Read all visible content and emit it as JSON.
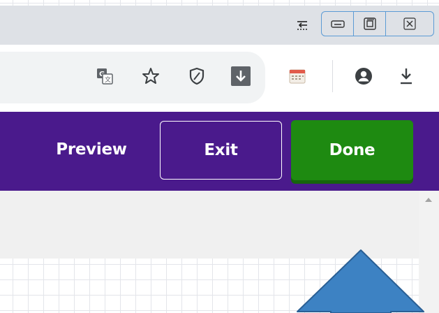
{
  "window_controls": {
    "pin_icon": "pin-icon",
    "minimize_icon": "minimize-icon",
    "restore_icon": "restore-icon",
    "close_icon": "close-icon"
  },
  "browser_toolbar": {
    "icons": [
      "translate-icon",
      "star-icon",
      "shield-icon",
      "download-box-icon",
      "calendar-extension-icon",
      "account-icon",
      "download-icon"
    ],
    "colors": {
      "titlebar": "#dee1e6",
      "omnibox": "#f1f3f4",
      "icon": "#3c4043",
      "download_box": "#5f6368"
    }
  },
  "editor_bar": {
    "preview_label": "Preview",
    "exit_label": "Exit",
    "done_label": "Done",
    "colors": {
      "bar": "#4a1a8c",
      "done": "#1e8a11",
      "text": "#ffffff"
    }
  },
  "annotation": {
    "shape": "up-arrow",
    "fill": "#3d82c3",
    "stroke": "#2a5f94"
  }
}
